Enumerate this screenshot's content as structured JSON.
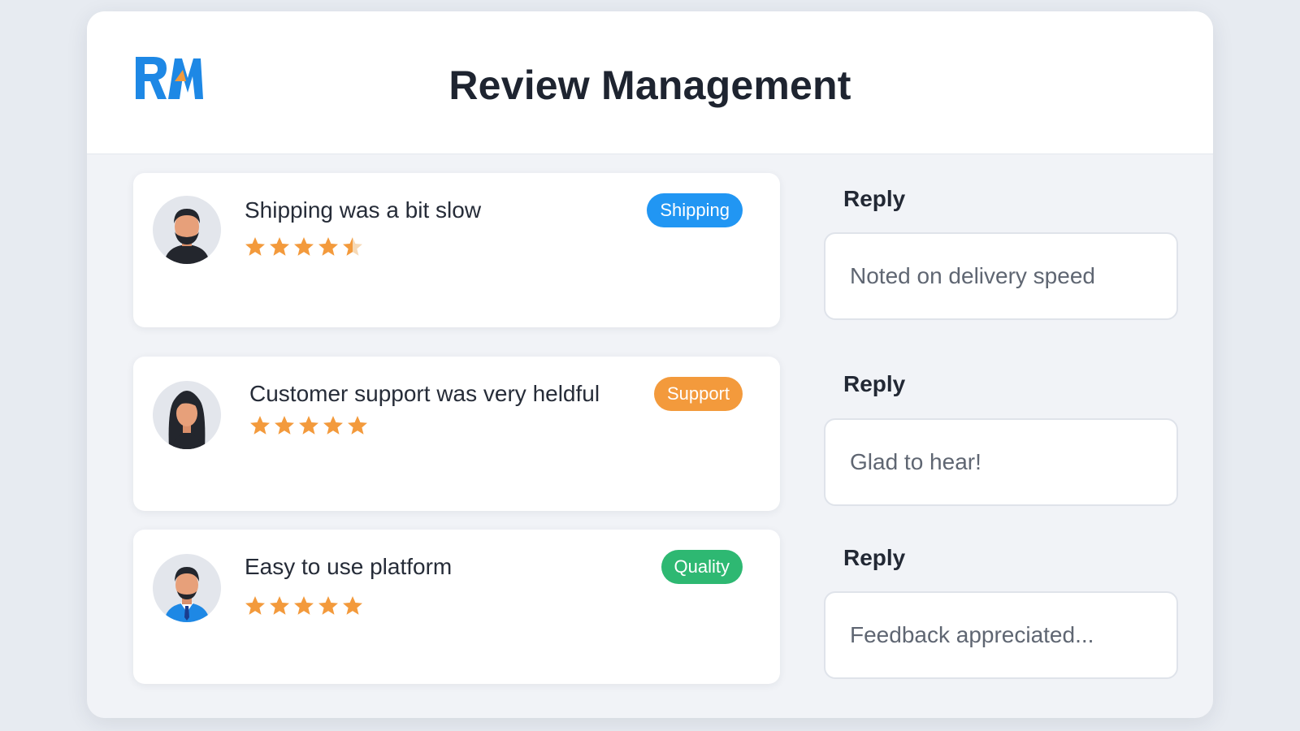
{
  "header": {
    "logo_text": "RM",
    "title": "Review Management"
  },
  "colors": {
    "logo_blue": "#1e88e5",
    "logo_orange": "#f39a3c",
    "star": "#f39a3c",
    "tag_shipping": "#2196f3",
    "tag_support": "#f39a3c",
    "tag_quality": "#2eb872"
  },
  "reviews": [
    {
      "text": "Shipping was a bit slow",
      "rating": 4.5,
      "tag": "Shipping",
      "tag_color": "#2196f3",
      "avatar_icon": "bearded-man-avatar-icon"
    },
    {
      "text": "Customer support was very heldful",
      "rating": 5,
      "tag": "Support",
      "tag_color": "#f39a3c",
      "avatar_icon": "woman-avatar-icon"
    },
    {
      "text": "Easy to use platform",
      "rating": 5,
      "tag": "Quality",
      "tag_color": "#2eb872",
      "avatar_icon": "man-with-tie-avatar-icon"
    }
  ],
  "replies": [
    {
      "label": "Reply",
      "value": "Noted on delivery speed"
    },
    {
      "label": "Reply",
      "value": "Glad to hear!"
    },
    {
      "label": "Reply",
      "value": "Feedback appreciated..."
    }
  ]
}
